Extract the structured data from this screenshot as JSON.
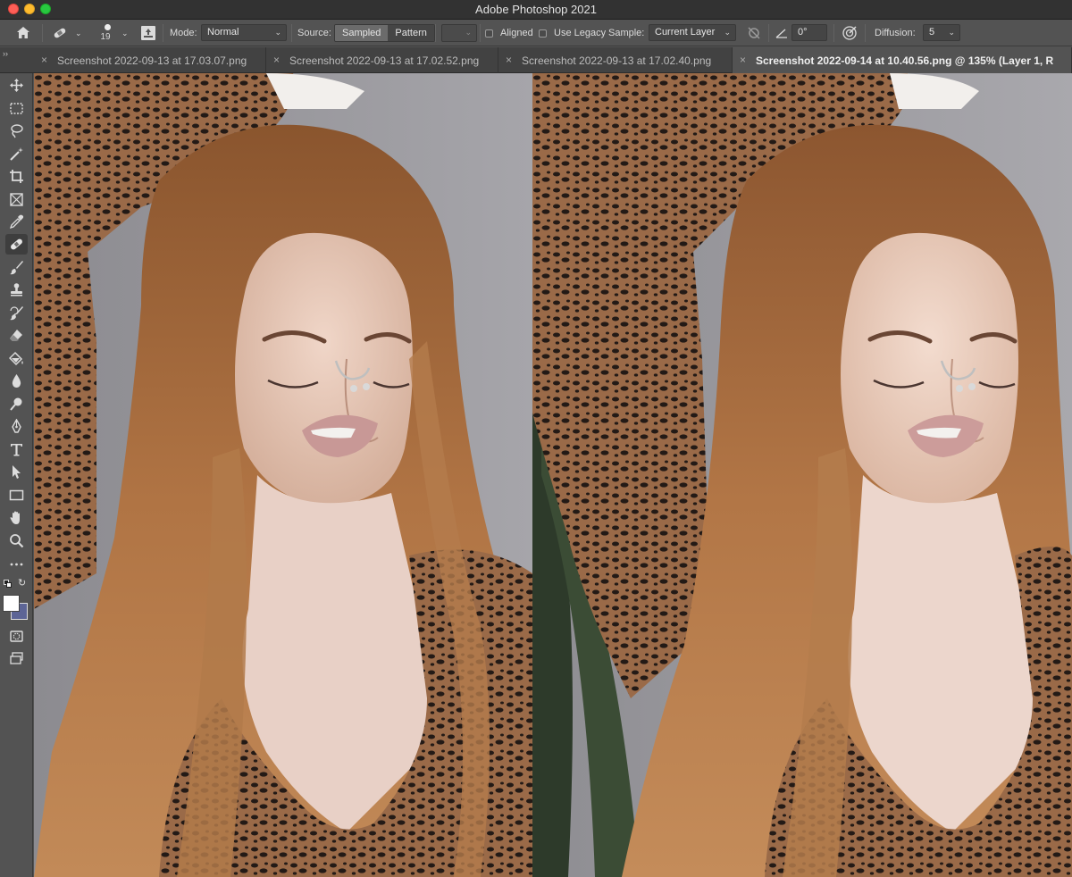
{
  "window": {
    "title": "Adobe Photoshop 2021"
  },
  "options_bar": {
    "brush_size": "19",
    "mode_label": "Mode:",
    "mode_value": "Normal",
    "source_label": "Source:",
    "source_options": [
      "Sampled",
      "Pattern"
    ],
    "source_selected": "Sampled",
    "aligned_label": "Aligned",
    "legacy_label": "Use Legacy",
    "sample_label": "Sample:",
    "sample_value": "Current Layer",
    "angle_value": "0°",
    "diffusion_label": "Diffusion:",
    "diffusion_value": "5"
  },
  "tabs": [
    {
      "label": "Screenshot 2022-09-13 at 17.03.07.png",
      "active": false
    },
    {
      "label": "Screenshot 2022-09-13 at 17.02.52.png",
      "active": false
    },
    {
      "label": "Screenshot 2022-09-13 at 17.02.40.png",
      "active": false
    },
    {
      "label": "Screenshot 2022-09-14 at 10.40.56.png @ 135% (Layer 1, R",
      "active": true
    }
  ],
  "tools": [
    "move-tool-icon",
    "marquee-tool-icon",
    "lasso-tool-icon",
    "magic-wand-icon",
    "crop-tool-icon",
    "frame-tool-icon",
    "eyedropper-icon",
    "healing-brush-icon",
    "brush-tool-icon",
    "clone-stamp-icon",
    "history-brush-icon",
    "eraser-icon",
    "paint-bucket-icon",
    "blur-tool-icon",
    "dodge-tool-icon",
    "pen-tool-icon",
    "type-tool-icon",
    "path-selection-icon",
    "rectangle-tool-icon",
    "hand-tool-icon",
    "zoom-tool-icon",
    "more-tools-icon"
  ],
  "colors": {
    "foreground": "#ffffff",
    "background": "#5d6596",
    "canvas_bg": "#9a999d",
    "hair": "#a86b3f",
    "skin": "#e6c8b7",
    "fabric": "#8a5c3e"
  }
}
